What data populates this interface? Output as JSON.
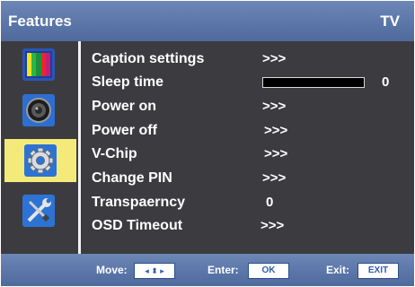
{
  "title": {
    "left": "Features",
    "right": "TV"
  },
  "sidebar": {
    "items": [
      {
        "icon": "picture-color-bars-icon"
      },
      {
        "icon": "sound-speaker-icon"
      },
      {
        "icon": "gear-icon",
        "selected": true
      },
      {
        "icon": "tools-wrench-screwdriver-icon"
      }
    ]
  },
  "menu": {
    "items": [
      {
        "label": "Caption settings",
        "value": ">>>"
      },
      {
        "label": "Sleep time",
        "value": "0",
        "slider_fraction": 0
      },
      {
        "label": "Power on",
        "value": ">>>"
      },
      {
        "label": "Power off",
        "value": ">>>"
      },
      {
        "label": "V-Chip",
        "value": ">>>"
      },
      {
        "label": "Change PIN",
        "value": ">>>"
      },
      {
        "label": "Transpaerncy",
        "value": "0"
      },
      {
        "label": "OSD Timeout",
        "value": ">>>"
      }
    ]
  },
  "footer": {
    "move_label": "Move:",
    "move_key": "◂ ⬍ ▸",
    "enter_label": "Enter:",
    "enter_key": "OK",
    "exit_label": "Exit:",
    "exit_key": "EXIT"
  },
  "colors": {
    "bar": "#5b76a8",
    "panel": "#3c3c40",
    "selected": "#f3ea7a"
  }
}
